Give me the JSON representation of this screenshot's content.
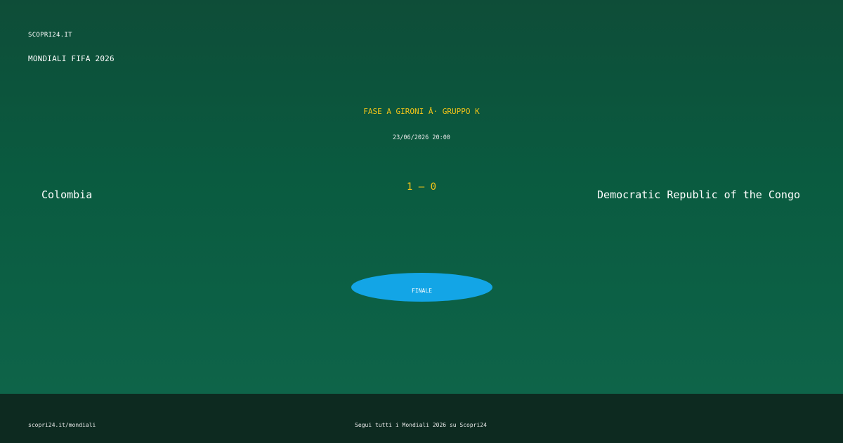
{
  "header": {
    "site": "SCOPRI24.IT",
    "tournament": "MONDIALI FIFA 2026"
  },
  "match": {
    "stage": "FASE A GIRONI Â· GRUPPO K",
    "datetime": "23/06/2026 20:00",
    "home_team": "Colombia",
    "away_team": "Democratic Republic of the Congo",
    "score": "1 – 0",
    "status": "FINALE"
  },
  "footer": {
    "url": "scopri24.it/mondiali",
    "cta": "Segui tutti i Mondiali 2026 su Scopri24"
  },
  "colors": {
    "background": "#0a5b40",
    "accent_yellow": "#f5c518",
    "status_blue": "#13a5e6",
    "footer_bg": "#0d2a20"
  }
}
